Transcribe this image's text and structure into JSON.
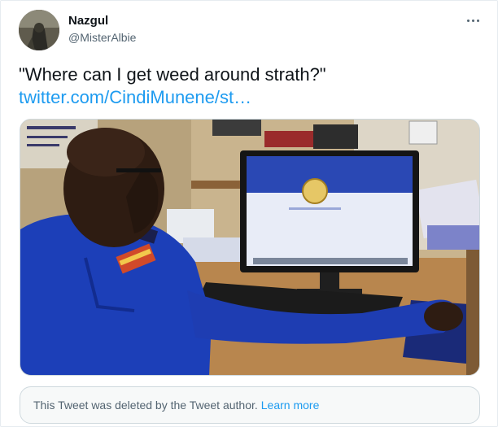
{
  "tweet": {
    "author_name": "Nazgul",
    "author_handle": "@MisterAlbie",
    "text": "\"Where can I get weed around strath?\"",
    "link_text": "twitter.com/CindiMunene/st…",
    "avatar_icon": "profile-avatar",
    "more_icon": "more-dots-icon"
  },
  "media": {
    "photo_icon": "photo-of-officer-at-computer"
  },
  "deleted_notice": {
    "message": "This Tweet was deleted by the Tweet author.",
    "learn_more": "Learn more"
  },
  "colors": {
    "link": "#1d9bf0",
    "secondary_text": "#536471",
    "uniform_blue": "#1c3fb8"
  }
}
